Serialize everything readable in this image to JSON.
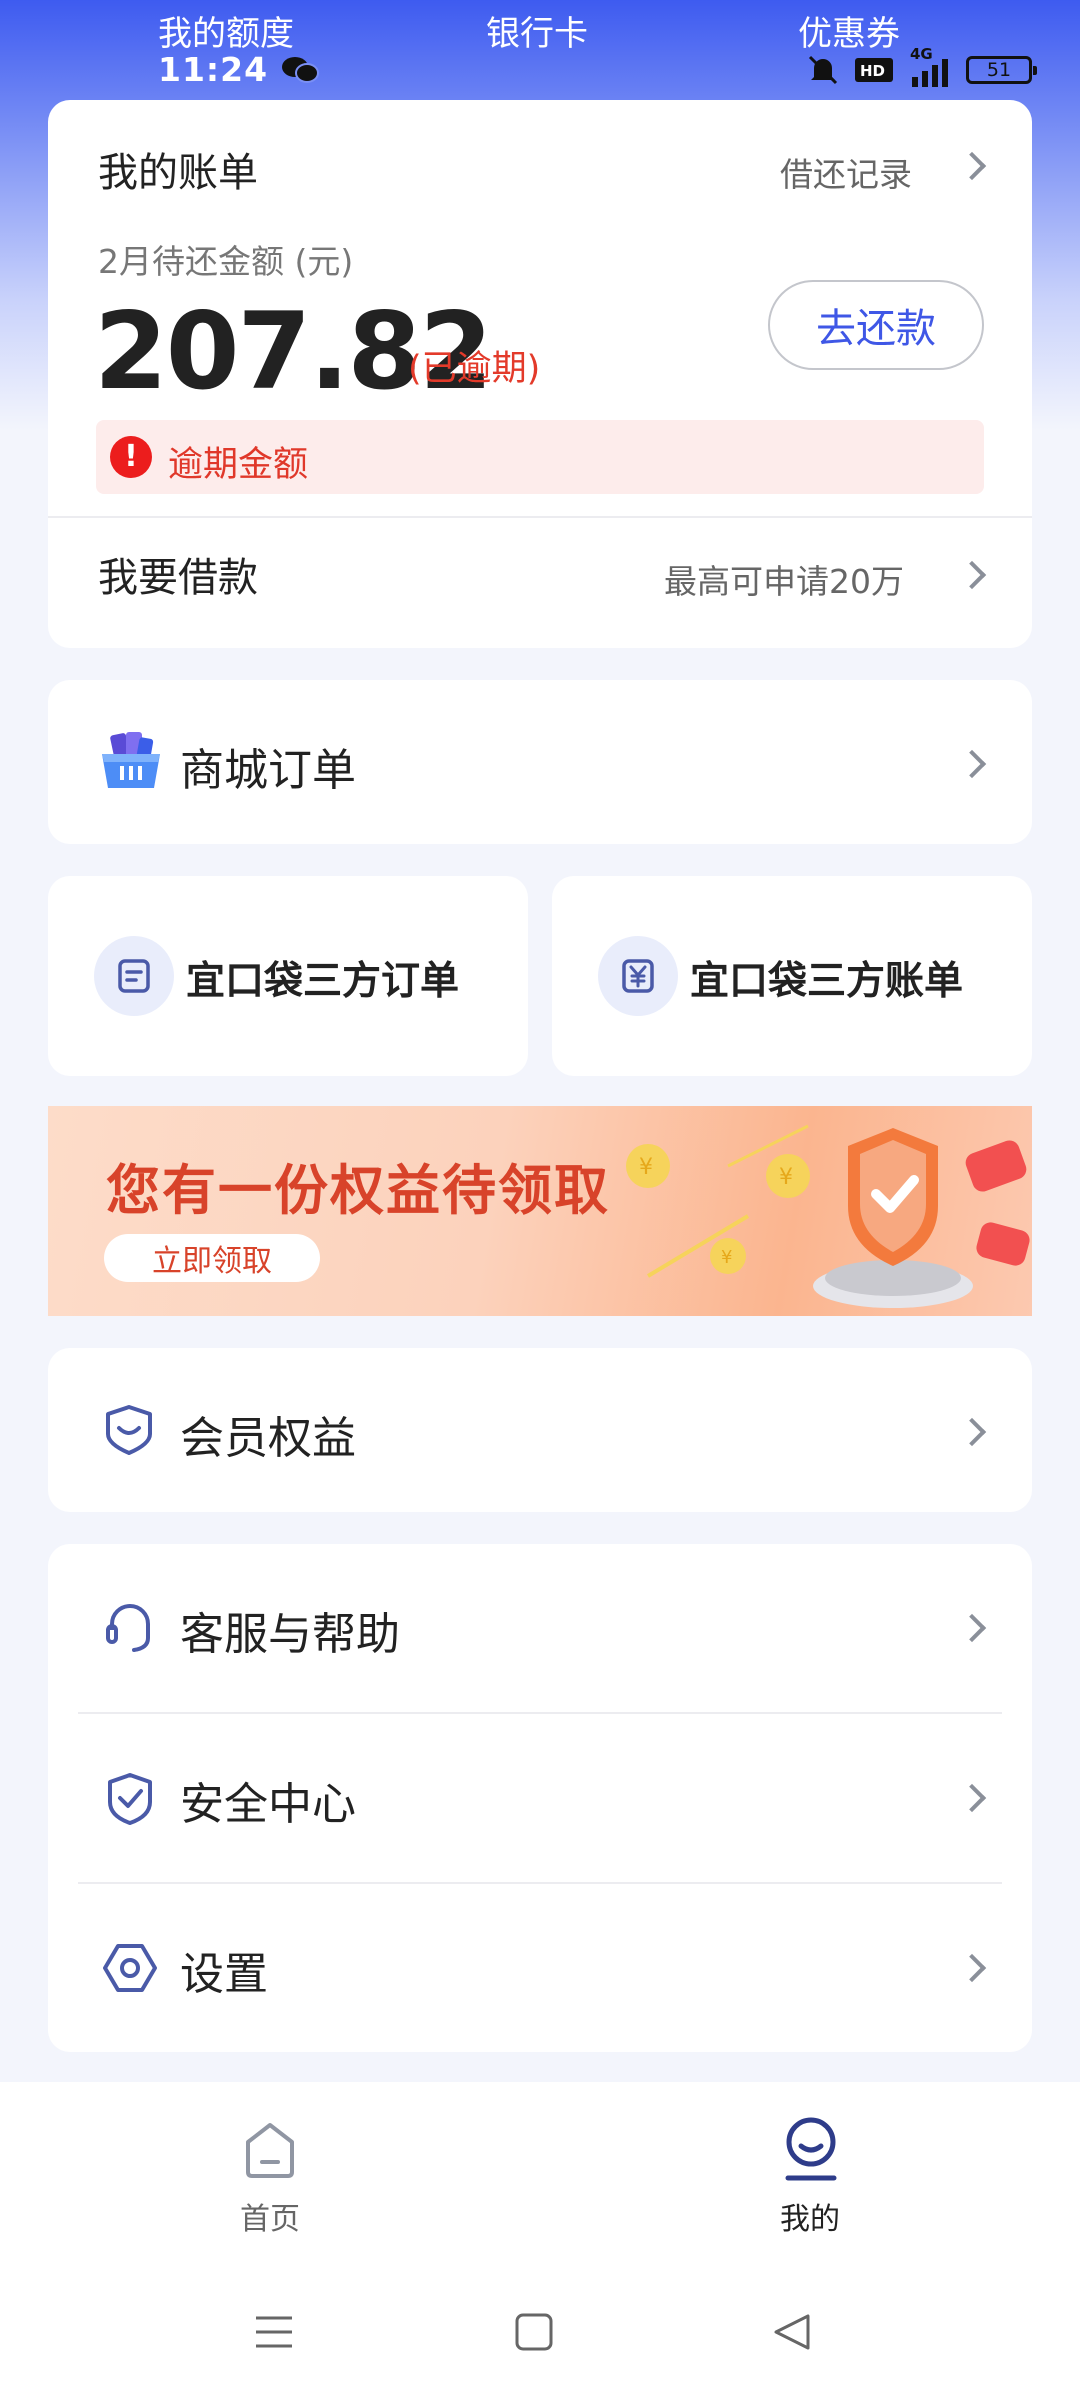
{
  "top_tabs": [
    "我的额度",
    "银行卡",
    "优惠券"
  ],
  "status_bar": {
    "time": "11:24",
    "network": "4G",
    "battery": "51"
  },
  "bill": {
    "title": "我的账单",
    "history_label": "借还记录",
    "due_label": "2月待还金额 (元)",
    "amount": "207.82",
    "overdue_tag": "(已逾期)",
    "repay_button": "去还款",
    "alert_text": "逾期金额"
  },
  "loan": {
    "title": "我要借款",
    "hint": "最高可申请20万"
  },
  "mall_order": {
    "label": "商城订单"
  },
  "third_party": [
    {
      "label": "宜口袋三方订单",
      "icon": "order-doc-icon"
    },
    {
      "label": "宜口袋三方账单",
      "icon": "yuan-bill-icon"
    }
  ],
  "banner": {
    "title": "您有一份权益待领取",
    "button": "立即领取"
  },
  "membership": {
    "label": "会员权益"
  },
  "menu": [
    {
      "label": "客服与帮助",
      "icon": "headset-icon"
    },
    {
      "label": "安全中心",
      "icon": "shield-icon"
    },
    {
      "label": "设置",
      "icon": "gear-icon"
    }
  ],
  "bottom_nav": [
    {
      "label": "首页",
      "icon": "home-icon",
      "active": false
    },
    {
      "label": "我的",
      "icon": "profile-icon",
      "active": true
    }
  ],
  "colors": {
    "accent": "#3f57e6",
    "danger": "#e33a2a",
    "icon": "#4a5aa8"
  }
}
